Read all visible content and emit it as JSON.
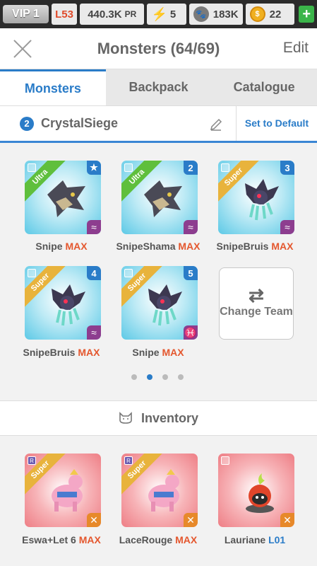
{
  "status": {
    "vip": "VIP 1",
    "level": "L53",
    "power": "440.3K",
    "power_unit": "PR",
    "energy": "5",
    "food": "183K",
    "gold": "22",
    "add": "+"
  },
  "header": {
    "title": "Monsters (64/69)",
    "edit": "Edit"
  },
  "tabs": [
    "Monsters",
    "Backpack",
    "Catalogue"
  ],
  "team": {
    "number": "2",
    "name": "CrystalSiege",
    "set_default": "Set to Default"
  },
  "team_monsters": [
    {
      "name": "Snipe",
      "status": "MAX",
      "rank": "Ultra",
      "slot": "★",
      "element": "≈"
    },
    {
      "name": "SnipeShama",
      "status": "MAX",
      "rank": "Ultra",
      "slot": "2",
      "element": "≈"
    },
    {
      "name": "SnipeBruis",
      "status": "MAX",
      "rank": "Super",
      "slot": "3",
      "element": "≈"
    },
    {
      "name": "SnipeBruis",
      "status": "MAX",
      "rank": "Super",
      "slot": "4",
      "element": "≈"
    },
    {
      "name": "Snipe",
      "status": "MAX",
      "rank": "Super",
      "slot": "5",
      "element": "♓"
    }
  ],
  "change_team": "Change Team",
  "pages": {
    "count": 4,
    "current": 2
  },
  "inventory": {
    "title": "Inventory",
    "monsters": [
      {
        "name": "Eswa+Let 6",
        "status": "MAX",
        "rank": "Super",
        "element": "✕"
      },
      {
        "name": "LaceRouge",
        "status": "MAX",
        "rank": "Super",
        "element": "✕"
      },
      {
        "name": "Lauriane",
        "status": "L01",
        "rank": "",
        "element": "✕"
      }
    ]
  }
}
